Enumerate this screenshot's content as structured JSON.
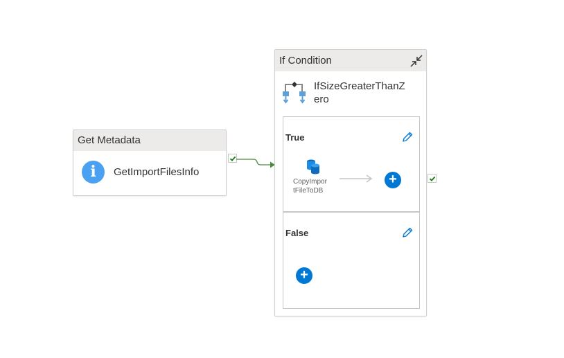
{
  "get_metadata": {
    "header": "Get Metadata",
    "name": "GetImportFilesInfo",
    "icon": "info-icon",
    "icon_glyph": "i",
    "icon_color": "#4aa1f1"
  },
  "if_condition": {
    "header": "If Condition",
    "name_line1": "IfSizeGreaterThanZ",
    "name_line2": "ero",
    "true_branch": {
      "label": "True",
      "activity_name_line1": "CopyImpor",
      "activity_name_line2": "tFileToDB",
      "add_glyph": "+"
    },
    "false_branch": {
      "label": "False",
      "add_glyph": "+"
    }
  },
  "colors": {
    "accent": "#0078d4",
    "success": "#107c10",
    "connector": "#4e8b3f",
    "header_bg": "#edebe9"
  }
}
